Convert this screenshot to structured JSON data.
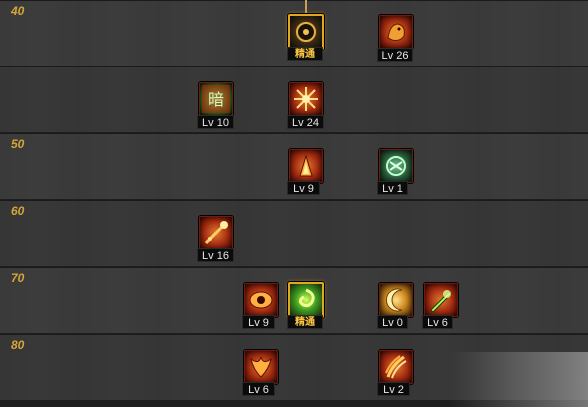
{
  "rows": [
    {
      "level": "40"
    },
    {
      "level": ""
    },
    {
      "level": "50"
    },
    {
      "level": "60"
    },
    {
      "level": "70"
    },
    {
      "level": "80"
    }
  ],
  "skills": {
    "r40_mid": {
      "label": "精通",
      "icon": "dark-orb-icon"
    },
    "r40_right": {
      "label": "Lv 26",
      "icon": "golden-beast-icon"
    },
    "r45_left": {
      "label": "Lv 10",
      "icon": "green-rune-icon"
    },
    "r45_mid": {
      "label": "Lv 24",
      "icon": "fire-burst-icon"
    },
    "r50_mid": {
      "label": "Lv 9",
      "icon": "flame-blade-icon"
    },
    "r50_right": {
      "label": "Lv 1",
      "icon": "green-sigil-icon"
    },
    "r60_left": {
      "label": "Lv 16",
      "icon": "fire-staff-icon"
    },
    "r70_a": {
      "label": "Lv 9",
      "icon": "fire-eye-icon"
    },
    "r70_b": {
      "label": "精通",
      "icon": "green-swirl-icon"
    },
    "r70_c": {
      "label": "Lv 0",
      "icon": "golden-crescent-icon"
    },
    "r70_d": {
      "label": "Lv 6",
      "icon": "green-blade-icon"
    },
    "r80_left": {
      "label": "Lv 6",
      "icon": "phoenix-icon"
    },
    "r80_right": {
      "label": "Lv 2",
      "icon": "fire-claw-icon"
    }
  }
}
